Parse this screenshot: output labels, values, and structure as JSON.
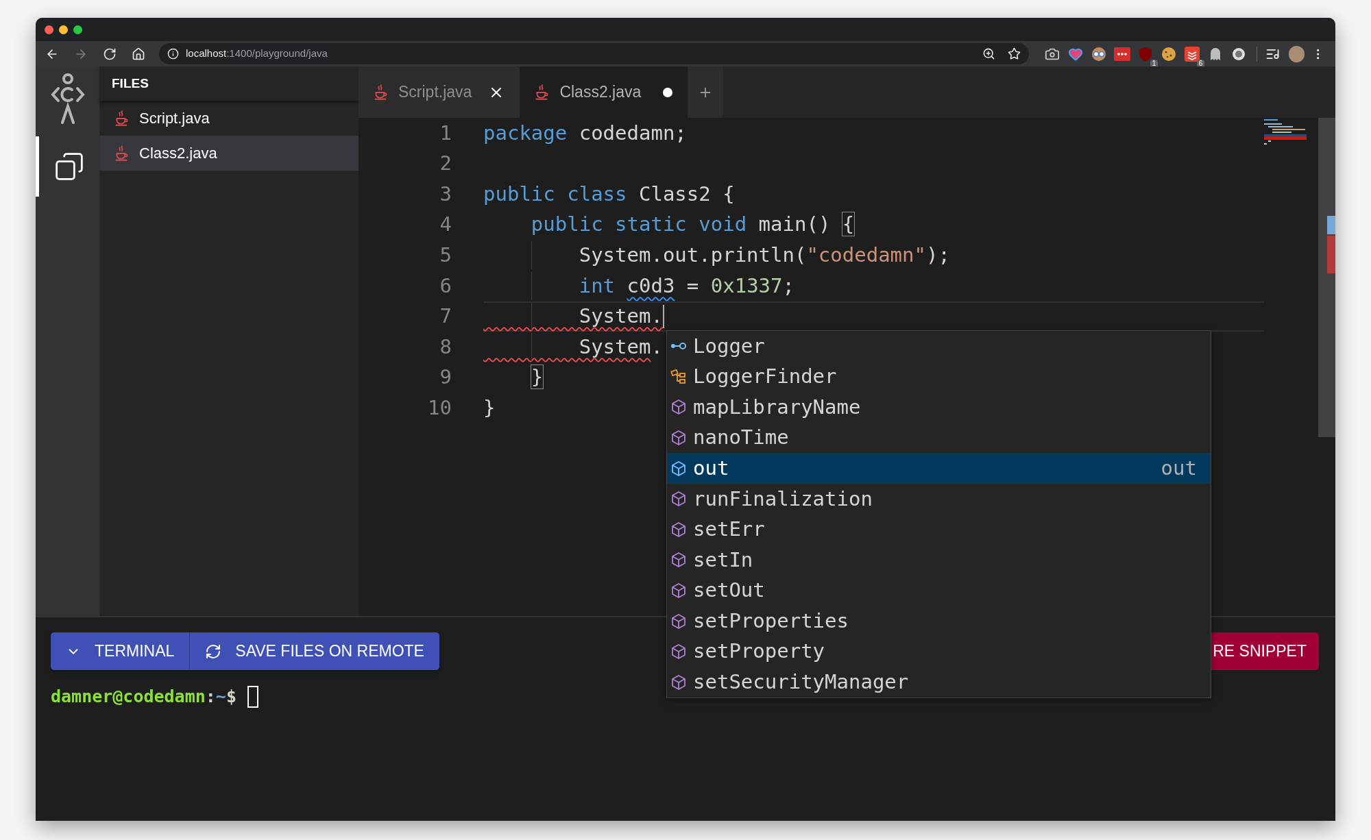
{
  "browser": {
    "nav": [
      {
        "kind": "back",
        "disabled": false
      },
      {
        "kind": "forward",
        "disabled": true
      },
      {
        "kind": "reload",
        "disabled": false
      },
      {
        "kind": "home",
        "disabled": false
      }
    ],
    "url": {
      "host": "localhost",
      "path": ":1400/playground/java"
    },
    "extensions": [
      {
        "kind": "camera"
      },
      {
        "kind": "heart"
      },
      {
        "kind": "goggles"
      },
      {
        "kind": "dots"
      },
      {
        "kind": "shield",
        "badge": "1"
      },
      {
        "kind": "cookie"
      },
      {
        "kind": "stack",
        "badge": "6"
      },
      {
        "kind": "ghost"
      },
      {
        "kind": "disc"
      }
    ]
  },
  "activity_bar": {
    "items": [
      {
        "kind": "files",
        "selected": true
      }
    ]
  },
  "sidebar": {
    "title": "FILES",
    "files": [
      {
        "name": "Script.java",
        "selected": false
      },
      {
        "name": "Class2.java",
        "selected": true
      }
    ]
  },
  "tabs": [
    {
      "label": "Script.java",
      "selected": false,
      "modified": false
    },
    {
      "label": "Class2.java",
      "selected": true,
      "modified": true
    }
  ],
  "editor": {
    "lines": [
      {
        "number": "1",
        "current": false,
        "tokens": [
          {
            "text": "package",
            "kind": "keyword"
          },
          {
            "text": " codedamn;",
            "kind": "plain"
          }
        ]
      },
      {
        "number": "2",
        "current": false
      },
      {
        "number": "3",
        "current": false,
        "tokens": [
          {
            "text": "public",
            "kind": "keyword"
          },
          {
            "text": " class",
            "kind": "keyword"
          },
          {
            "text": " Class2 {",
            "kind": "plain"
          }
        ]
      },
      {
        "number": "4",
        "current": false,
        "tokens": [
          {
            "text": "    public",
            "kind": "keyword"
          },
          {
            "text": " static",
            "kind": "keyword"
          },
          {
            "text": " void",
            "kind": "keyword"
          },
          {
            "text": " main() ",
            "kind": "plain"
          },
          {
            "text": "{",
            "kind": "bracket"
          }
        ]
      },
      {
        "number": "5",
        "current": false,
        "tokens": [
          {
            "text": "        System.out.println(",
            "kind": "plain"
          },
          {
            "text": "\"codedamn\"",
            "kind": "string"
          },
          {
            "text": ");",
            "kind": "plain"
          }
        ]
      },
      {
        "number": "6",
        "current": false,
        "tokens": [
          {
            "text": "        int",
            "kind": "keyword"
          },
          {
            "text": " c0d3",
            "kind": "warning"
          },
          {
            "text": " = ",
            "kind": "plain"
          },
          {
            "text": "0x1337",
            "kind": "number"
          },
          {
            "text": ";",
            "kind": "plain"
          }
        ]
      },
      {
        "number": "7",
        "current": true,
        "tokens": [
          {
            "text": "        System.",
            "kind": "error"
          }
        ]
      },
      {
        "number": "8",
        "current": false,
        "tokens": [
          {
            "text": "        System",
            "kind": "error"
          },
          {
            "text": ".",
            "kind": "plain"
          }
        ]
      },
      {
        "number": "9",
        "current": false,
        "tokens": [
          {
            "text": "    }",
            "kind": "bracket"
          }
        ]
      },
      {
        "number": "10",
        "current": false,
        "tokens": [
          {
            "text": "}",
            "kind": "plain"
          }
        ]
      }
    ]
  },
  "suggestions": [
    {
      "label": "Logger",
      "kind": "interface",
      "selected": false
    },
    {
      "label": "LoggerFinder",
      "kind": "class",
      "selected": false
    },
    {
      "label": "mapLibraryName",
      "kind": "method",
      "selected": false
    },
    {
      "label": "nanoTime",
      "kind": "method",
      "selected": false
    },
    {
      "label": "out",
      "kind": "method",
      "selected": true,
      "detail": "out"
    },
    {
      "label": "runFinalization",
      "kind": "method",
      "selected": false
    },
    {
      "label": "setErr",
      "kind": "method",
      "selected": false
    },
    {
      "label": "setIn",
      "kind": "method",
      "selected": false
    },
    {
      "label": "setOut",
      "kind": "method",
      "selected": false
    },
    {
      "label": "setProperties",
      "kind": "method",
      "selected": false
    },
    {
      "label": "setProperty",
      "kind": "method",
      "selected": false
    },
    {
      "label": "setSecurityManager",
      "kind": "method",
      "selected": false
    }
  ],
  "panel": {
    "buttons": [
      {
        "kind": "terminal",
        "label": "TERMINAL"
      },
      {
        "kind": "save",
        "label": "SAVE FILES ON REMOTE"
      }
    ],
    "share": {
      "label": "RE SNIPPET"
    }
  },
  "terminal": {
    "user": "damner@codedamn",
    "separator": ":",
    "dir": "~",
    "prompt": "$"
  }
}
